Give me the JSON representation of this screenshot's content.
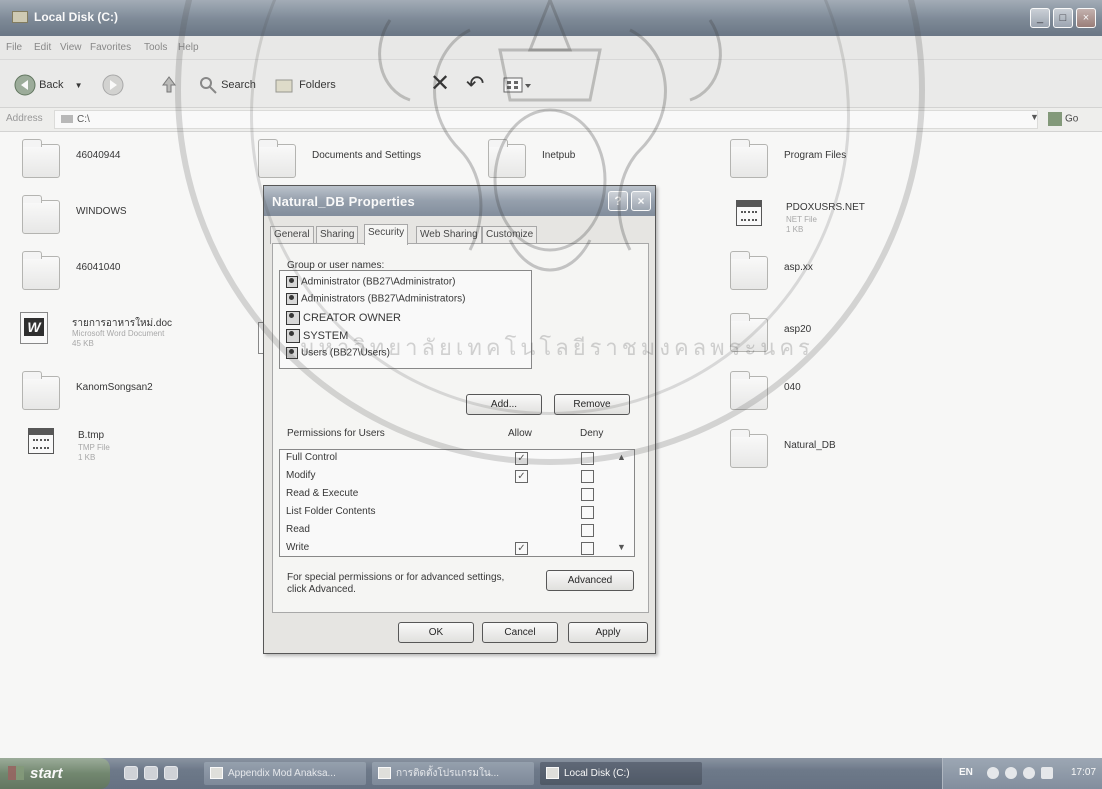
{
  "window": {
    "title": "Local Disk (C:)",
    "menu": [
      "File",
      "Edit",
      "View",
      "Favorites",
      "Tools",
      "Help"
    ]
  },
  "toolbar": {
    "back_label": "Back",
    "search_label": "Search",
    "folders_label": "Folders"
  },
  "address": {
    "label": "Address",
    "value": "C:\\",
    "go_label": "Go"
  },
  "files": [
    {
      "name": "46040944",
      "type": "folder"
    },
    {
      "name": "WINDOWS",
      "type": "folder"
    },
    {
      "name": "46041040",
      "type": "folder"
    },
    {
      "name": "รายการอาหารใหม่.doc",
      "sub1": "Microsoft Word Document",
      "sub2": "45 KB",
      "type": "word"
    },
    {
      "name": "KanomSongsan2",
      "type": "folder"
    },
    {
      "name": "B.tmp",
      "sub1": "TMP File",
      "sub2": "1 KB",
      "type": "tmp"
    },
    {
      "name": "Documents and Settings",
      "type": "folder"
    },
    {
      "name": "Inetpub",
      "type": "folder"
    },
    {
      "name": "Program Files",
      "type": "folder"
    },
    {
      "name": "PDOXUSRS.NET",
      "sub1": "NET File",
      "sub2": "1 KB",
      "type": "net"
    },
    {
      "name": "asp.xx",
      "type": "folder"
    },
    {
      "name": "asp20",
      "type": "folder"
    },
    {
      "name": "040",
      "type": "folder"
    },
    {
      "name": "Natural_DB",
      "type": "folder"
    }
  ],
  "dialog": {
    "title": "Natural_DB Properties",
    "help_label": "?",
    "close_label": "×",
    "tabs": [
      "General",
      "Sharing",
      "Security",
      "Web Sharing",
      "Customize"
    ],
    "active_tab": "Security",
    "group_label": "Group or user names:",
    "groups": [
      "Administrator (BB27\\Administrator)",
      "Administrators (BB27\\Administrators)",
      "CREATOR OWNER",
      "SYSTEM",
      "Users (BB27\\Users)"
    ],
    "add_label": "Add...",
    "remove_label": "Remove",
    "permissions_label": "Permissions for Users",
    "allow_label": "Allow",
    "deny_label": "Deny",
    "permissions": [
      {
        "name": "Full Control",
        "allow": true,
        "deny": false
      },
      {
        "name": "Modify",
        "allow": true,
        "deny": false
      },
      {
        "name": "Read & Execute",
        "allow": false,
        "deny": false
      },
      {
        "name": "List Folder Contents",
        "allow": false,
        "deny": false
      },
      {
        "name": "Read",
        "allow": false,
        "deny": false
      },
      {
        "name": "Write",
        "allow": true,
        "deny": false
      }
    ],
    "special_text_1": "For special permissions or for advanced settings,",
    "special_text_2": "click Advanced.",
    "advanced_label": "Advanced",
    "ok_label": "OK",
    "cancel_label": "Cancel",
    "apply_label": "Apply"
  },
  "taskbar": {
    "start_label": "start",
    "tasks": [
      {
        "label": "Appendix Mod Anaksa...",
        "active": false
      },
      {
        "label": "การติดตั้งโปรแกรมใน...",
        "active": false
      },
      {
        "label": "Local Disk (C:)",
        "active": true
      }
    ],
    "lang": "EN",
    "time": "17:07"
  },
  "watermark": {
    "text": "มหาวิทยาลัยเทคโนโลยีราชมงคลพระนคร"
  },
  "colors": {
    "titlebar": "#7f98b8",
    "start_button": "#5e8f58",
    "taskbar": "#5e7aa0"
  }
}
